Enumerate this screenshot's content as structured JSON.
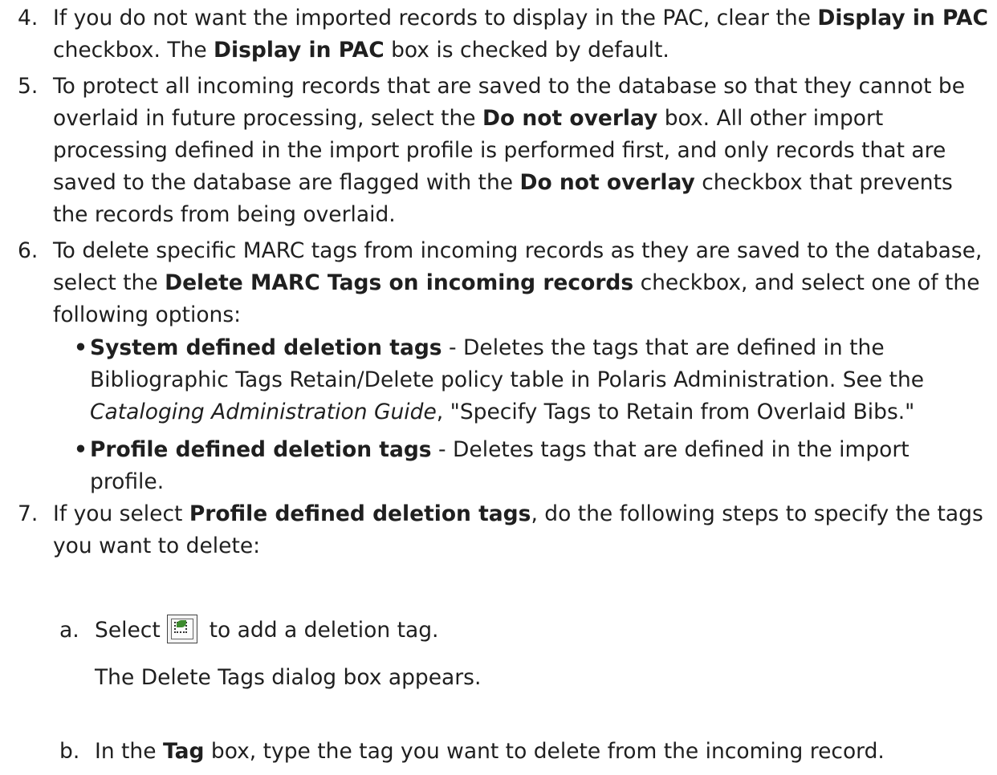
{
  "steps": [
    {
      "number": "4.",
      "segments": [
        {
          "t": "If you do not want the imported records to display in the PAC, clear the "
        },
        {
          "t": "Display in PAC",
          "b": true
        },
        {
          "t": " checkbox. The "
        },
        {
          "t": "Display in PAC",
          "b": true
        },
        {
          "t": " box is checked by default."
        }
      ]
    },
    {
      "number": "5.",
      "segments": [
        {
          "t": "To protect all incoming records that are saved to the database so that they cannot be overlaid in future processing, select the "
        },
        {
          "t": "Do not overlay",
          "b": true
        },
        {
          "t": " box. All other import processing defined in the import profile is performed first, and only records that are saved to the database are flagged with the "
        },
        {
          "t": "Do not overlay",
          "b": true
        },
        {
          "t": " checkbox that prevents the records from being overlaid."
        }
      ]
    },
    {
      "number": "6.",
      "segments": [
        {
          "t": "To delete specific MARC tags from incoming records as they are saved to the database, select the "
        },
        {
          "t": "Delete MARC Tags on incoming records",
          "b": true
        },
        {
          "t": " checkbox, and select one of the following options:"
        }
      ],
      "bullets": [
        {
          "segments": [
            {
              "t": "System defined deletion tags",
              "b": true
            },
            {
              "t": " - Deletes the tags that are defined in the Bibliographic Tags Retain/Delete policy table in Polaris Administration. See the "
            },
            {
              "t": "Cataloging Administration Guide",
              "i": true
            },
            {
              "t": ", \"Specify Tags to Retain from Overlaid Bibs.\""
            }
          ]
        },
        {
          "segments": [
            {
              "t": "Profile defined deletion tags",
              "b": true
            },
            {
              "t": " - Deletes tags that are defined in the import profile."
            }
          ]
        }
      ]
    },
    {
      "number": "7.",
      "segments": [
        {
          "t": "If you select "
        },
        {
          "t": "Profile defined deletion tags",
          "b": true
        },
        {
          "t": ", do the following steps to specify the tags you want to delete:"
        }
      ],
      "substeps": [
        {
          "letter": "a.",
          "before": "Select",
          "icon": "add-deletion-tag-icon",
          "after": " to add a deletion tag.",
          "note": "The Delete Tags dialog box appears."
        },
        {
          "letter": "b.",
          "segments": [
            {
              "t": "In the "
            },
            {
              "t": "Tag",
              "b": true
            },
            {
              "t": " box, type the tag you want to delete from the incoming record."
            }
          ]
        }
      ]
    }
  ]
}
